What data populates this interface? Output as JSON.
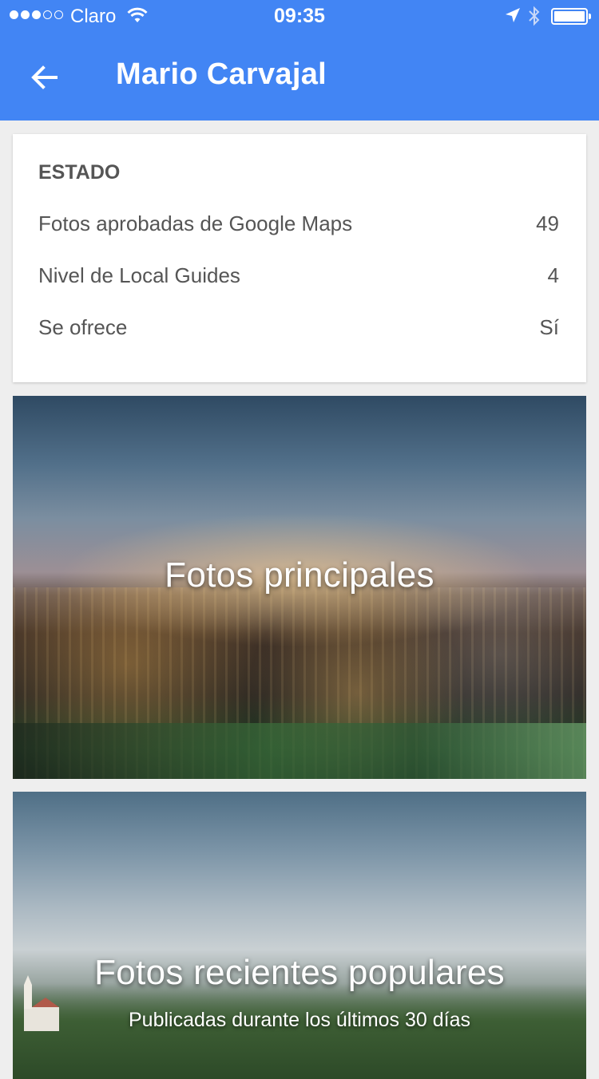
{
  "status_bar": {
    "carrier": "Claro",
    "time": "09:35",
    "signal_bars_filled": 3,
    "signal_bars_total": 5,
    "icons": [
      "wifi-icon",
      "location-arrow-icon",
      "bluetooth-icon",
      "battery-icon"
    ]
  },
  "app_bar": {
    "title": "Mario Carvajal",
    "back_icon": "arrow-back-icon",
    "color": "#4285f4"
  },
  "status_card": {
    "heading": "ESTADO",
    "rows": [
      {
        "label": "Fotos aprobadas de Google Maps",
        "value": "49"
      },
      {
        "label": "Nivel de Local Guides",
        "value": "4"
      },
      {
        "label": "Se ofrece",
        "value": "Sí"
      }
    ]
  },
  "panels": [
    {
      "title": "Fotos principales"
    },
    {
      "title": "Fotos recientes populares",
      "subtitle": "Publicadas durante los últimos 30 días"
    }
  ]
}
